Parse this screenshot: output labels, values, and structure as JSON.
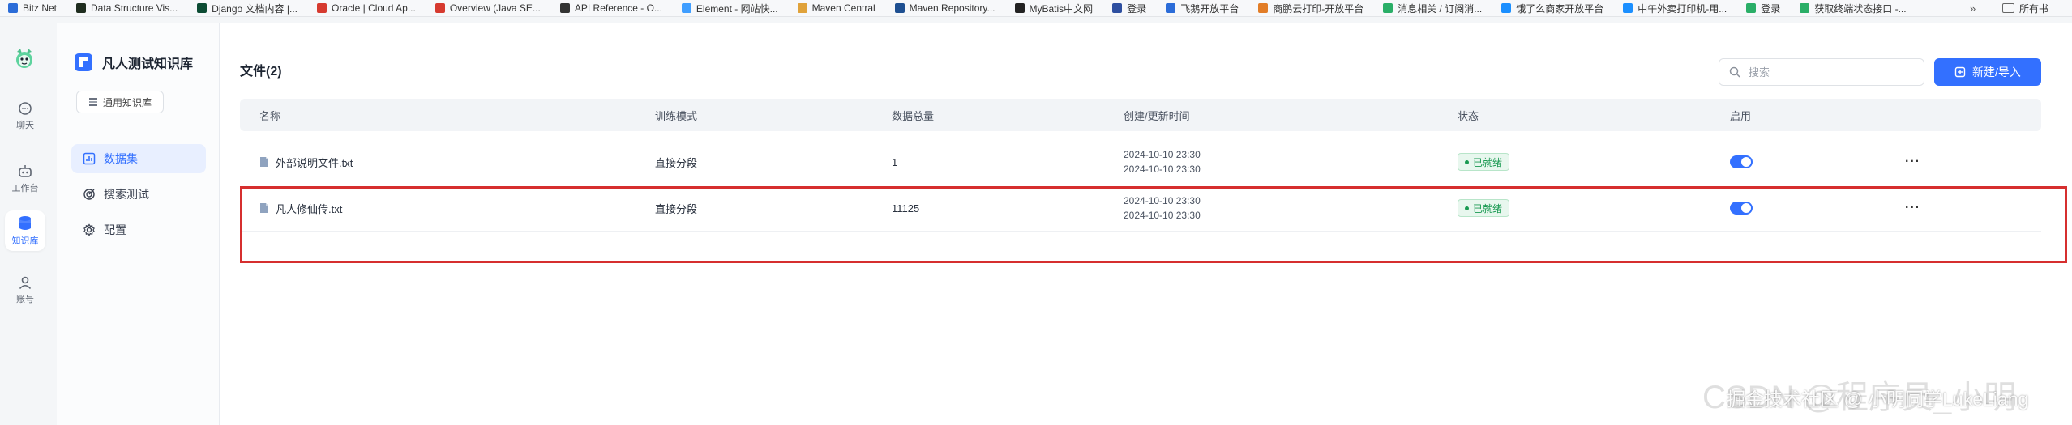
{
  "bookmarks": [
    {
      "label": "Bitz Net",
      "color": "#2b6cd8"
    },
    {
      "label": "Data Structure Vis...",
      "color": "#1f2d1f"
    },
    {
      "label": "Django 文档内容 |...",
      "color": "#0c4b33"
    },
    {
      "label": "Oracle | Cloud Ap...",
      "color": "#d63a2f"
    },
    {
      "label": "Overview (Java SE...",
      "color": "#d63a2f"
    },
    {
      "label": "API Reference - O...",
      "color": "#333333"
    },
    {
      "label": "Element - 网站快...",
      "color": "#409eff"
    },
    {
      "label": "Maven Central",
      "color": "#e0a23a"
    },
    {
      "label": "Maven Repository...",
      "color": "#1e4f91"
    },
    {
      "label": "MyBatis中文网",
      "color": "#222222"
    },
    {
      "label": "登录",
      "color": "#2e4fa0"
    },
    {
      "label": "飞鹅开放平台",
      "color": "#2b6cd8"
    },
    {
      "label": "商鹏云打印-开放平台",
      "color": "#e27d27"
    },
    {
      "label": "消息相关 / 订阅消...",
      "color": "#2aae67"
    },
    {
      "label": "饿了么商家开放平台",
      "color": "#1b8fff"
    },
    {
      "label": "中午外卖打印机-用...",
      "color": "#1b8fff"
    },
    {
      "label": "登录",
      "color": "#2aae67"
    },
    {
      "label": "获取终端状态接口 -...",
      "color": "#2aae67"
    }
  ],
  "bookmarks_more": "»",
  "bookmarks_folder": "所有书",
  "rail": [
    {
      "label": "聊天"
    },
    {
      "label": "工作台"
    },
    {
      "label": "知识库"
    },
    {
      "label": "账号"
    }
  ],
  "sidebar": {
    "kb_title": "凡人测试知识库",
    "kb_type": "通用知识库",
    "menu": [
      {
        "label": "数据集"
      },
      {
        "label": "搜索测试"
      },
      {
        "label": "配置"
      }
    ]
  },
  "main": {
    "files_title": "文件(2)",
    "search_placeholder": "搜索",
    "new_button": "新建/导入",
    "columns": [
      "名称",
      "训练模式",
      "数据总量",
      "创建/更新时间",
      "状态",
      "启用"
    ],
    "rows": [
      {
        "name": "外部说明文件.txt",
        "mode": "直接分段",
        "count": "1",
        "created": "2024-10-10 23:30",
        "updated": "2024-10-10 23:30",
        "status": "已就绪",
        "enabled": true
      },
      {
        "name": "凡人修仙传.txt",
        "mode": "直接分段",
        "count": "11125",
        "created": "2024-10-10 23:30",
        "updated": "2024-10-10 23:30",
        "status": "已就绪",
        "enabled": true
      }
    ]
  },
  "watermark": {
    "back": "CSDN @程序员_小明",
    "front": "掘金技术社区 @ 小明同学LukeLiang"
  },
  "colors": {
    "accent": "#3370ff",
    "ready": "#1a9a52",
    "highlight": "#d62f2f"
  }
}
